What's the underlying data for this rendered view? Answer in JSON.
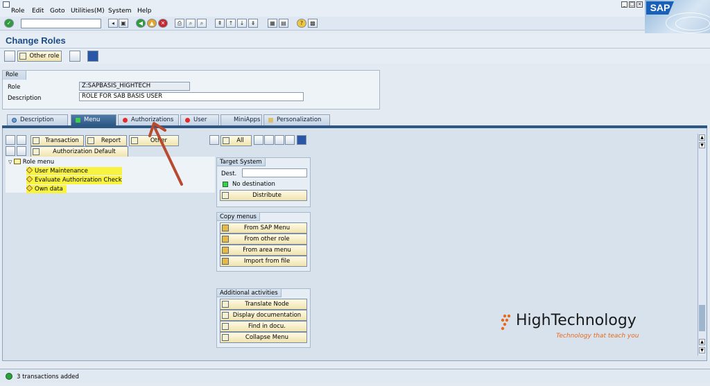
{
  "menubar": {
    "items": [
      "Role",
      "Edit",
      "Goto",
      "Utilities(M)",
      "System",
      "Help"
    ]
  },
  "app": {
    "title": "Change Roles"
  },
  "appbar": {
    "other_role": "Other role"
  },
  "role_group": {
    "title": "Role",
    "role_label": "Role",
    "role_value": "Z:SAPBASIS_HIGHTECH",
    "desc_label": "Description",
    "desc_value": "ROLE FOR SAB BASIS USER"
  },
  "tabs": [
    {
      "label": "Description",
      "status": "none"
    },
    {
      "label": "Menu",
      "status": "green"
    },
    {
      "label": "Authorizations",
      "status": "red"
    },
    {
      "label": "User",
      "status": "red"
    },
    {
      "label": "MiniApps",
      "status": "none"
    },
    {
      "label": "Personalization",
      "status": "none"
    }
  ],
  "menu_toolbar": {
    "transaction": "Transaction",
    "report": "Report",
    "other": "Other",
    "auth_default": "Authorization Default",
    "all": "All"
  },
  "tree": {
    "root": "Role menu",
    "items": [
      "User Maintenance",
      "Evaluate Authorization Check",
      "Own data"
    ]
  },
  "target_system": {
    "title": "Target System",
    "dest_label": "Dest.",
    "dest_value": "",
    "status": "No destination",
    "distribute": "Distribute"
  },
  "copy_menus": {
    "title": "Copy menus",
    "buttons": [
      "From SAP Menu",
      "From other role",
      "From area menu",
      "Import from file"
    ]
  },
  "additional": {
    "title": "Additional activities",
    "buttons": [
      "Translate Node",
      "Display documentation",
      "Find in docu.",
      "Collapse Menu"
    ]
  },
  "brand": {
    "name": "HighTechnology",
    "tagline": "Technology that teach you"
  },
  "status": {
    "message": "3 transactions added"
  },
  "colors": {
    "accent": "#2e5884",
    "title": "#1c4c84",
    "highlight": "#f8f340",
    "arrow": "#b84a2f",
    "brand_orange": "#e8691c"
  }
}
